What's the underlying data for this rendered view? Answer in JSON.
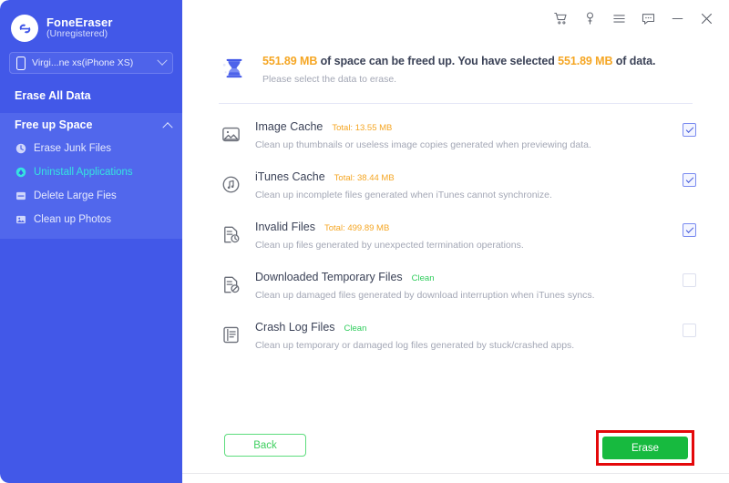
{
  "app": {
    "brand_name": "FoneEraser",
    "brand_status": "(Unregistered)",
    "accent_blue": "#4258e8",
    "accent_orange": "#f5a623",
    "accent_green": "#2ecc5b",
    "accent_cyan": "#35e4e0",
    "highlight_red": "#e4080a"
  },
  "sidebar": {
    "device": {
      "label": "Virgi...ne xs(iPhone XS)",
      "icon": "phone-icon",
      "chevron": "chevron-down-icon"
    },
    "erase_all_data": "Erase All Data",
    "group": {
      "title": "Free up Space",
      "chevron": "chevron-up-icon",
      "items": [
        {
          "label": "Erase Junk Files",
          "icon": "clock-icon",
          "active": false
        },
        {
          "label": "Uninstall Applications",
          "icon": "uninstall-icon",
          "active": true
        },
        {
          "label": "Delete Large Fies",
          "icon": "large-files-icon",
          "active": false
        },
        {
          "label": "Clean up Photos",
          "icon": "photos-icon",
          "active": false
        }
      ]
    }
  },
  "titlebar": {
    "buttons": [
      {
        "name": "cart-icon",
        "label": "cart"
      },
      {
        "name": "key-icon",
        "label": "key"
      },
      {
        "name": "menu-icon",
        "label": "menu"
      },
      {
        "name": "chat-icon",
        "label": "chat"
      },
      {
        "name": "minimize-icon",
        "label": "minimize"
      },
      {
        "name": "close-icon",
        "label": "close"
      }
    ]
  },
  "banner": {
    "icon": "hourglass-icon",
    "freed_amount": "551.89 MB",
    "text_mid": " of space can be freed up. You have selected ",
    "selected_amount": "551.89 MB",
    "text_end": " of data.",
    "subtitle": "Please select the data to erase."
  },
  "rows": [
    {
      "icon": "image-cache-icon",
      "title": "Image Cache",
      "total": "Total: 13.55 MB",
      "total_state": "size",
      "desc": "Clean up thumbnails or useless image copies generated when previewing data.",
      "checked": true
    },
    {
      "icon": "itunes-cache-icon",
      "title": "iTunes Cache",
      "total": "Total: 38.44 MB",
      "total_state": "size",
      "desc": "Clean up incomplete files generated when iTunes cannot synchronize.",
      "checked": true
    },
    {
      "icon": "invalid-files-icon",
      "title": "Invalid Files",
      "total": "Total: 499.89 MB",
      "total_state": "size",
      "desc": "Clean up files generated by unexpected termination operations.",
      "checked": true
    },
    {
      "icon": "downloaded-temp-files-icon",
      "title": "Downloaded Temporary Files",
      "total": "Clean",
      "total_state": "clean",
      "desc": "Clean up damaged files generated by download interruption when iTunes syncs.",
      "checked": false
    },
    {
      "icon": "crash-log-files-icon",
      "title": "Crash Log Files",
      "total": "Clean",
      "total_state": "clean",
      "desc": "Clean up temporary or damaged log files generated by stuck/crashed apps.",
      "checked": false
    }
  ],
  "footer": {
    "back_label": "Back",
    "erase_label": "Erase"
  }
}
